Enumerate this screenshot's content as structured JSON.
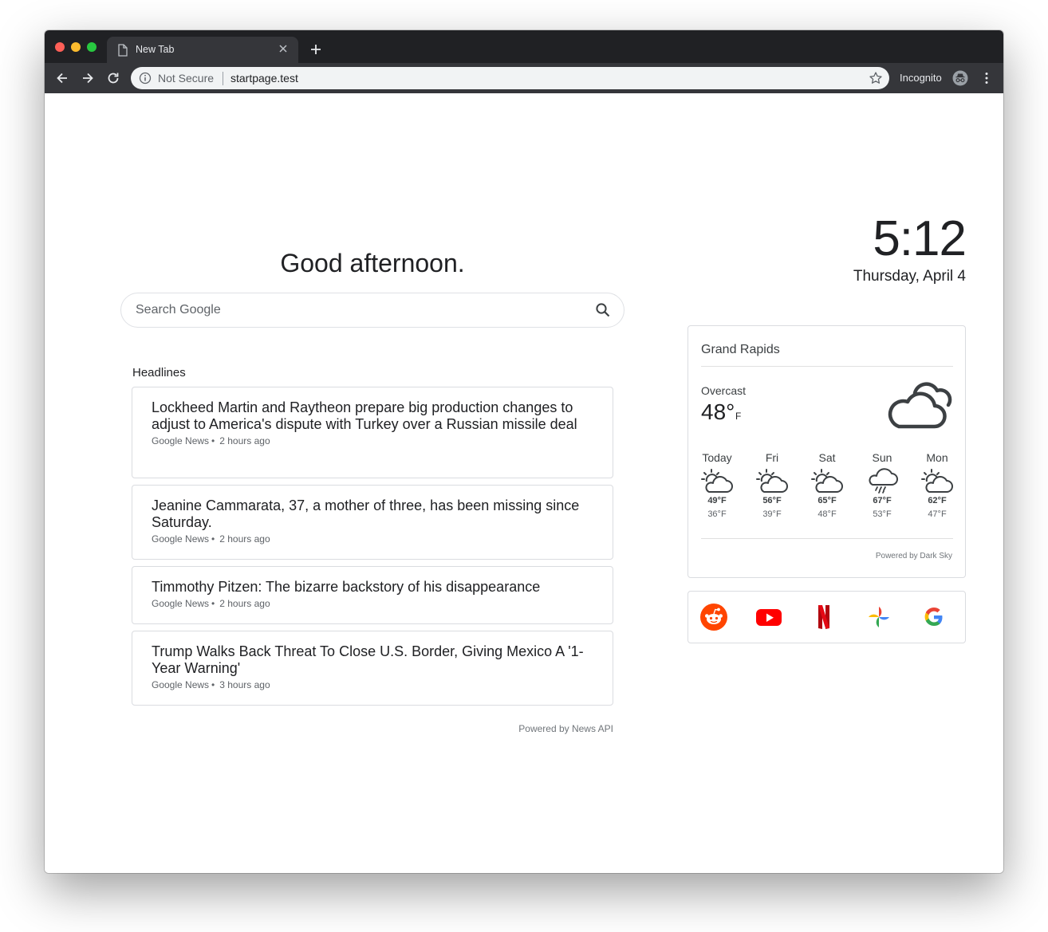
{
  "browser": {
    "tab_title": "New Tab",
    "security_label": "Not Secure",
    "url": "startpage.test",
    "incognito_label": "Incognito"
  },
  "greeting": "Good afternoon.",
  "search": {
    "placeholder": "Search Google"
  },
  "headlines": {
    "title": "Headlines",
    "items": [
      {
        "headline": "Lockheed Martin and Raytheon prepare big production changes to adjust to America's dispute with Turkey over a Russian missile deal",
        "source": "Google News",
        "time": "2 hours ago"
      },
      {
        "headline": "Jeanine Cammarata, 37, a mother of three, has been missing since Saturday.",
        "source": "Google News",
        "time": "2 hours ago"
      },
      {
        "headline": "Timmothy Pitzen: The bizarre backstory of his disappearance",
        "source": "Google News",
        "time": "2 hours ago"
      },
      {
        "headline": "Trump Walks Back Threat To Close U.S. Border, Giving Mexico A '1-Year Warning'",
        "source": "Google News",
        "time": "3 hours ago"
      }
    ],
    "powered_by": "Powered by News API"
  },
  "clock": {
    "time": "5:12",
    "date": "Thursday, April 4"
  },
  "weather": {
    "city": "Grand Rapids",
    "condition": "Overcast",
    "temperature": "48°",
    "unit": "F",
    "current_icon": "cloudy-icon",
    "forecast": [
      {
        "day": "Today",
        "icon": "partly-cloudy-icon",
        "high": "49°F",
        "low": "36°F"
      },
      {
        "day": "Fri",
        "icon": "partly-cloudy-icon",
        "high": "56°F",
        "low": "39°F"
      },
      {
        "day": "Sat",
        "icon": "partly-cloudy-icon",
        "high": "65°F",
        "low": "48°F"
      },
      {
        "day": "Sun",
        "icon": "rain-icon",
        "high": "67°F",
        "low": "53°F"
      },
      {
        "day": "Mon",
        "icon": "partly-cloudy-icon",
        "high": "62°F",
        "low": "47°F"
      }
    ],
    "powered_by": "Powered by Dark Sky"
  },
  "quick_links": [
    {
      "name": "reddit",
      "icon": "reddit-icon",
      "color": "#ff4500"
    },
    {
      "name": "youtube",
      "icon": "youtube-icon",
      "color": "#ff0000"
    },
    {
      "name": "netflix",
      "icon": "netflix-icon",
      "color": "#e50914"
    },
    {
      "name": "google-photos",
      "icon": "google-photos-icon",
      "color": "#fbbc04"
    },
    {
      "name": "google",
      "icon": "google-icon",
      "color": "#4285f4"
    }
  ],
  "colors": {
    "chrome_dark": "#202124",
    "chrome_toolbar": "#35363a",
    "card_border": "#dadce0",
    "text_primary": "#202124",
    "text_secondary": "#5f6368"
  }
}
